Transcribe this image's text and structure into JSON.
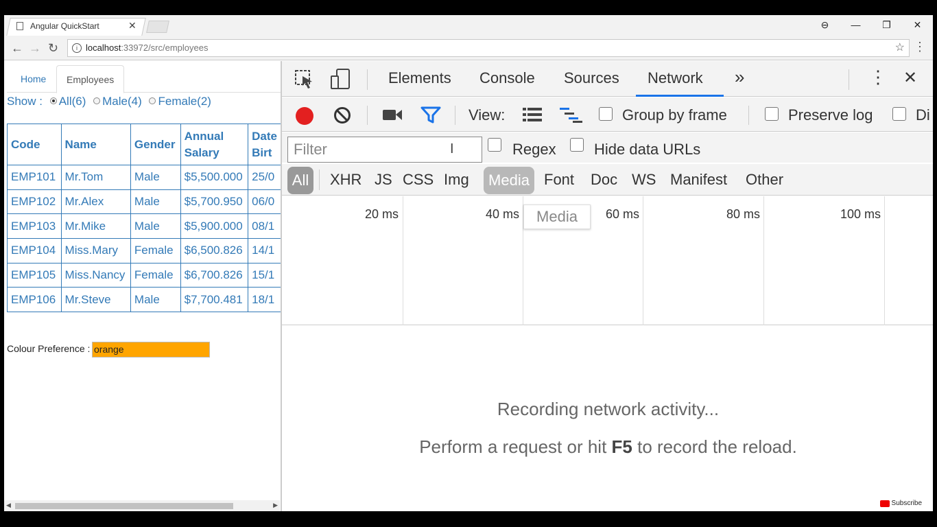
{
  "browser": {
    "tab_title": "Angular QuickStart",
    "tab_close": "✕",
    "url_host": "localhost",
    "url_rest": ":33972/src/employees",
    "window_buttons": [
      "⊖",
      "—",
      "❐",
      "✕"
    ]
  },
  "page": {
    "nav_tabs": [
      "Home",
      "Employees"
    ],
    "show_label": "Show :",
    "filter_options": [
      "All(6)",
      "Male(4)",
      "Female(2)"
    ],
    "table": {
      "headers": [
        "Code",
        "Name",
        "Gender",
        "Annual Salary",
        "Date of Birth"
      ],
      "header_visible": [
        "Code",
        "Name",
        "Gender",
        "Annual\nSalary",
        "Date\nBirt"
      ],
      "rows": [
        [
          "EMP101",
          "Mr.Tom",
          "Male",
          "$5,500.000",
          "25/0"
        ],
        [
          "EMP102",
          "Mr.Alex",
          "Male",
          "$5,700.950",
          "06/0"
        ],
        [
          "EMP103",
          "Mr.Mike",
          "Male",
          "$5,900.000",
          "08/1"
        ],
        [
          "EMP104",
          "Miss.Mary",
          "Female",
          "$6,500.826",
          "14/1"
        ],
        [
          "EMP105",
          "Miss.Nancy",
          "Female",
          "$6,700.826",
          "15/1"
        ],
        [
          "EMP106",
          "Mr.Steve",
          "Male",
          "$7,700.481",
          "18/1"
        ]
      ]
    },
    "colour_label": "Colour Preference :",
    "colour_value": "orange",
    "colour_hex": "#ffa500"
  },
  "devtools": {
    "tabs": [
      "Elements",
      "Console",
      "Sources",
      "Network"
    ],
    "more": "»",
    "close": "✕",
    "view_label": "View:",
    "group_by_frame": "Group by frame",
    "preserve_log": "Preserve log",
    "disable_cache_partial": "Di",
    "filter_placeholder": "Filter",
    "regex": "Regex",
    "hide_data_urls": "Hide data URLs",
    "types": [
      "All",
      "XHR",
      "JS",
      "CSS",
      "Img",
      "Media",
      "Font",
      "Doc",
      "WS",
      "Manifest",
      "Other"
    ],
    "tooltip": "Media",
    "ticks": [
      "20 ms",
      "40 ms",
      "60 ms",
      "80 ms",
      "100 ms"
    ],
    "empty_line1": "Recording network activity...",
    "empty_line2_pre": "Perform a request or hit ",
    "empty_line2_key": "F5",
    "empty_line2_post": " to record the reload."
  },
  "overlay": {
    "subscribe": "Subscribe"
  }
}
